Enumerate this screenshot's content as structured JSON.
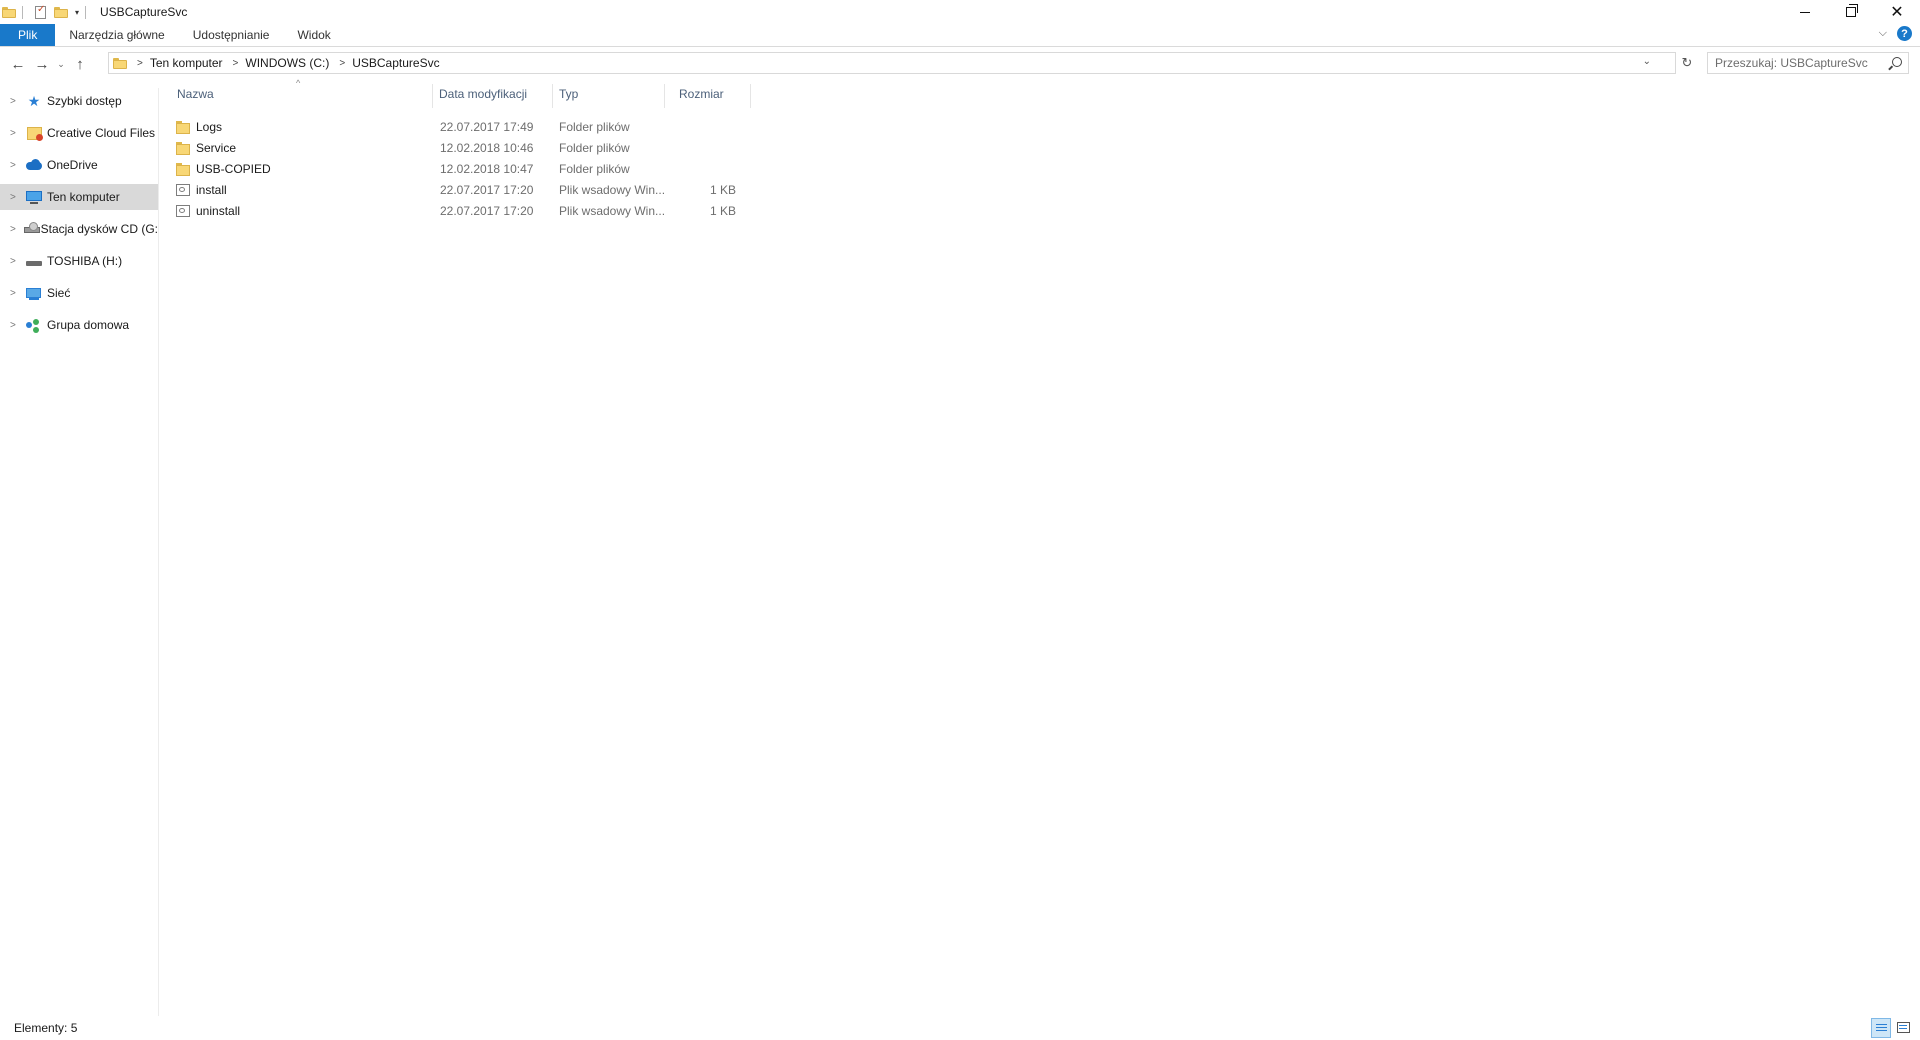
{
  "window": {
    "title": "USBCaptureSvc",
    "qat_dropdown_glyph": "▾",
    "minimize_glyph": "",
    "close_glyph": "✕"
  },
  "ribbon": {
    "tabs": [
      "Plik",
      "Narzędzia główne",
      "Udostępnianie",
      "Widok"
    ],
    "expand_glyph": "⌵",
    "help_glyph": "?"
  },
  "nav": {
    "back_glyph": "←",
    "forward_glyph": "→",
    "recent_glyph": "⌄",
    "up_glyph": "↑"
  },
  "address": {
    "breadcrumbs": [
      "Ten komputer",
      "WINDOWS (C:)",
      "USBCaptureSvc"
    ],
    "separator_glyph": ">",
    "dropdown_glyph": "⌄",
    "refresh_glyph": "↻"
  },
  "search": {
    "placeholder": "Przeszukaj: USBCaptureSvc"
  },
  "sidebar": {
    "items": [
      {
        "label": "Szybki dostęp",
        "icon": "star-icon"
      },
      {
        "label": "Creative Cloud Files",
        "icon": "creative-cloud-icon"
      },
      {
        "label": "OneDrive",
        "icon": "cloud-icon"
      },
      {
        "label": "Ten komputer",
        "icon": "computer-icon",
        "selected": true
      },
      {
        "label": "Stacja dysków CD (G:",
        "icon": "cd-drive-icon"
      },
      {
        "label": "TOSHIBA (H:)",
        "icon": "drive-icon"
      },
      {
        "label": "Sieć",
        "icon": "network-icon"
      },
      {
        "label": "Grupa domowa",
        "icon": "homegroup-icon"
      }
    ],
    "expander_glyph": ">"
  },
  "filelist": {
    "columns": {
      "name": "Nazwa",
      "date": "Data modyfikacji",
      "type": "Typ",
      "size": "Rozmiar"
    },
    "sort_glyph": "^",
    "rows": [
      {
        "name": "Logs",
        "date": "22.07.2017 17:49",
        "type": "Folder plików",
        "size": "",
        "icon": "folder-icon"
      },
      {
        "name": "Service",
        "date": "12.02.2018 10:46",
        "type": "Folder plików",
        "size": "",
        "icon": "folder-icon"
      },
      {
        "name": "USB-COPIED",
        "date": "12.02.2018 10:47",
        "type": "Folder plików",
        "size": "",
        "icon": "folder-icon"
      },
      {
        "name": "install",
        "date": "22.07.2017 17:20",
        "type": "Plik wsadowy Win...",
        "size": "1 KB",
        "icon": "batch-file-icon"
      },
      {
        "name": "uninstall",
        "date": "22.07.2017 17:20",
        "type": "Plik wsadowy Win...",
        "size": "1 KB",
        "icon": "batch-file-icon"
      }
    ]
  },
  "status": {
    "text": "Elementy: 5"
  }
}
